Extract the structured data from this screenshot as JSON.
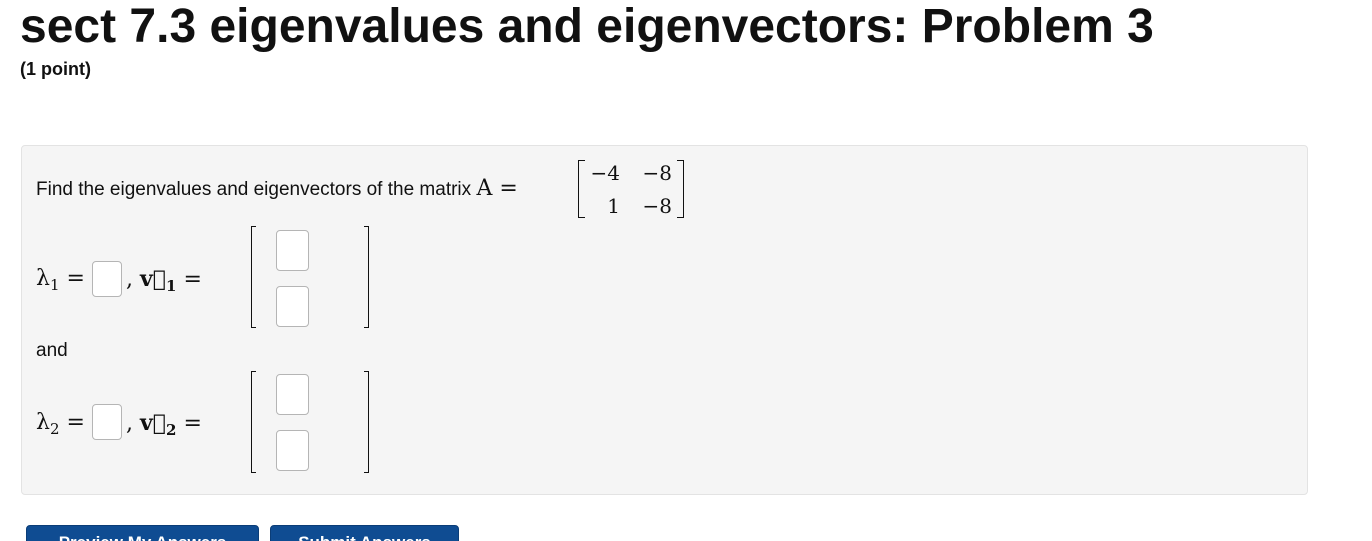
{
  "header": {
    "title": "sect 7.3 eigenvalues and eigenvectors: Problem 3",
    "points": "(1 point)"
  },
  "problem": {
    "prompt": "Find the eigenvalues and eigenvectors of the matrix",
    "matrix_symbol": "A =",
    "matrix": [
      [
        "−4",
        "−8"
      ],
      [
        "1",
        "−8"
      ]
    ],
    "and_text": "and",
    "rows": [
      {
        "lambda_symbol": "λ",
        "lambda_sub": "1",
        "equals": "=",
        "comma": ",",
        "vector_symbol": "v⃗",
        "vector_sub": "1",
        "vector_equals": "="
      },
      {
        "lambda_symbol": "λ",
        "lambda_sub": "2",
        "equals": "=",
        "comma": ",",
        "vector_symbol": "v⃗",
        "vector_sub": "2",
        "vector_equals": "="
      }
    ]
  },
  "buttons": {
    "preview": "Preview My Answers",
    "submit": "Submit Answers"
  },
  "colors": {
    "button_bg": "#0f4c92",
    "panel_bg": "#f5f5f5"
  }
}
